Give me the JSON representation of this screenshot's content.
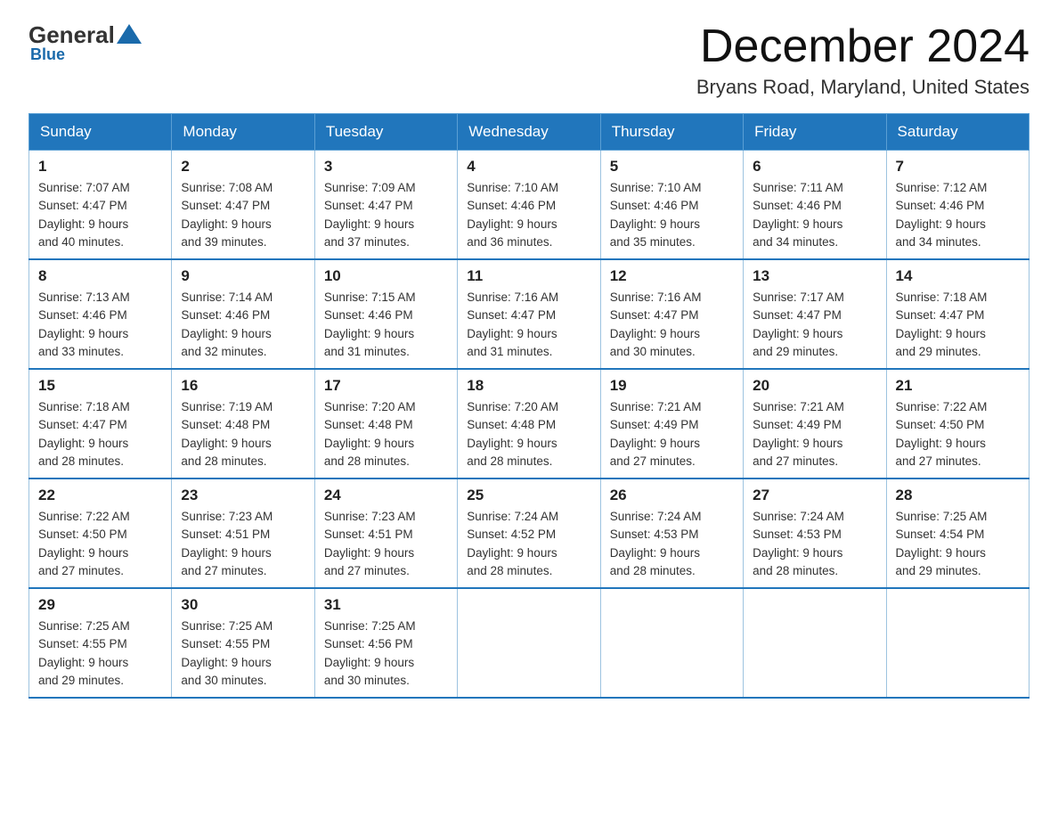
{
  "logo": {
    "general": "General",
    "blue": "Blue"
  },
  "header": {
    "month_title": "December 2024",
    "location": "Bryans Road, Maryland, United States"
  },
  "days_of_week": [
    "Sunday",
    "Monday",
    "Tuesday",
    "Wednesday",
    "Thursday",
    "Friday",
    "Saturday"
  ],
  "weeks": [
    [
      {
        "day": "1",
        "sunrise": "7:07 AM",
        "sunset": "4:47 PM",
        "daylight": "9 hours and 40 minutes."
      },
      {
        "day": "2",
        "sunrise": "7:08 AM",
        "sunset": "4:47 PM",
        "daylight": "9 hours and 39 minutes."
      },
      {
        "day": "3",
        "sunrise": "7:09 AM",
        "sunset": "4:47 PM",
        "daylight": "9 hours and 37 minutes."
      },
      {
        "day": "4",
        "sunrise": "7:10 AM",
        "sunset": "4:46 PM",
        "daylight": "9 hours and 36 minutes."
      },
      {
        "day": "5",
        "sunrise": "7:10 AM",
        "sunset": "4:46 PM",
        "daylight": "9 hours and 35 minutes."
      },
      {
        "day": "6",
        "sunrise": "7:11 AM",
        "sunset": "4:46 PM",
        "daylight": "9 hours and 34 minutes."
      },
      {
        "day": "7",
        "sunrise": "7:12 AM",
        "sunset": "4:46 PM",
        "daylight": "9 hours and 34 minutes."
      }
    ],
    [
      {
        "day": "8",
        "sunrise": "7:13 AM",
        "sunset": "4:46 PM",
        "daylight": "9 hours and 33 minutes."
      },
      {
        "day": "9",
        "sunrise": "7:14 AM",
        "sunset": "4:46 PM",
        "daylight": "9 hours and 32 minutes."
      },
      {
        "day": "10",
        "sunrise": "7:15 AM",
        "sunset": "4:46 PM",
        "daylight": "9 hours and 31 minutes."
      },
      {
        "day": "11",
        "sunrise": "7:16 AM",
        "sunset": "4:47 PM",
        "daylight": "9 hours and 31 minutes."
      },
      {
        "day": "12",
        "sunrise": "7:16 AM",
        "sunset": "4:47 PM",
        "daylight": "9 hours and 30 minutes."
      },
      {
        "day": "13",
        "sunrise": "7:17 AM",
        "sunset": "4:47 PM",
        "daylight": "9 hours and 29 minutes."
      },
      {
        "day": "14",
        "sunrise": "7:18 AM",
        "sunset": "4:47 PM",
        "daylight": "9 hours and 29 minutes."
      }
    ],
    [
      {
        "day": "15",
        "sunrise": "7:18 AM",
        "sunset": "4:47 PM",
        "daylight": "9 hours and 28 minutes."
      },
      {
        "day": "16",
        "sunrise": "7:19 AM",
        "sunset": "4:48 PM",
        "daylight": "9 hours and 28 minutes."
      },
      {
        "day": "17",
        "sunrise": "7:20 AM",
        "sunset": "4:48 PM",
        "daylight": "9 hours and 28 minutes."
      },
      {
        "day": "18",
        "sunrise": "7:20 AM",
        "sunset": "4:48 PM",
        "daylight": "9 hours and 28 minutes."
      },
      {
        "day": "19",
        "sunrise": "7:21 AM",
        "sunset": "4:49 PM",
        "daylight": "9 hours and 27 minutes."
      },
      {
        "day": "20",
        "sunrise": "7:21 AM",
        "sunset": "4:49 PM",
        "daylight": "9 hours and 27 minutes."
      },
      {
        "day": "21",
        "sunrise": "7:22 AM",
        "sunset": "4:50 PM",
        "daylight": "9 hours and 27 minutes."
      }
    ],
    [
      {
        "day": "22",
        "sunrise": "7:22 AM",
        "sunset": "4:50 PM",
        "daylight": "9 hours and 27 minutes."
      },
      {
        "day": "23",
        "sunrise": "7:23 AM",
        "sunset": "4:51 PM",
        "daylight": "9 hours and 27 minutes."
      },
      {
        "day": "24",
        "sunrise": "7:23 AM",
        "sunset": "4:51 PM",
        "daylight": "9 hours and 27 minutes."
      },
      {
        "day": "25",
        "sunrise": "7:24 AM",
        "sunset": "4:52 PM",
        "daylight": "9 hours and 28 minutes."
      },
      {
        "day": "26",
        "sunrise": "7:24 AM",
        "sunset": "4:53 PM",
        "daylight": "9 hours and 28 minutes."
      },
      {
        "day": "27",
        "sunrise": "7:24 AM",
        "sunset": "4:53 PM",
        "daylight": "9 hours and 28 minutes."
      },
      {
        "day": "28",
        "sunrise": "7:25 AM",
        "sunset": "4:54 PM",
        "daylight": "9 hours and 29 minutes."
      }
    ],
    [
      {
        "day": "29",
        "sunrise": "7:25 AM",
        "sunset": "4:55 PM",
        "daylight": "9 hours and 29 minutes."
      },
      {
        "day": "30",
        "sunrise": "7:25 AM",
        "sunset": "4:55 PM",
        "daylight": "9 hours and 30 minutes."
      },
      {
        "day": "31",
        "sunrise": "7:25 AM",
        "sunset": "4:56 PM",
        "daylight": "9 hours and 30 minutes."
      },
      null,
      null,
      null,
      null
    ]
  ]
}
